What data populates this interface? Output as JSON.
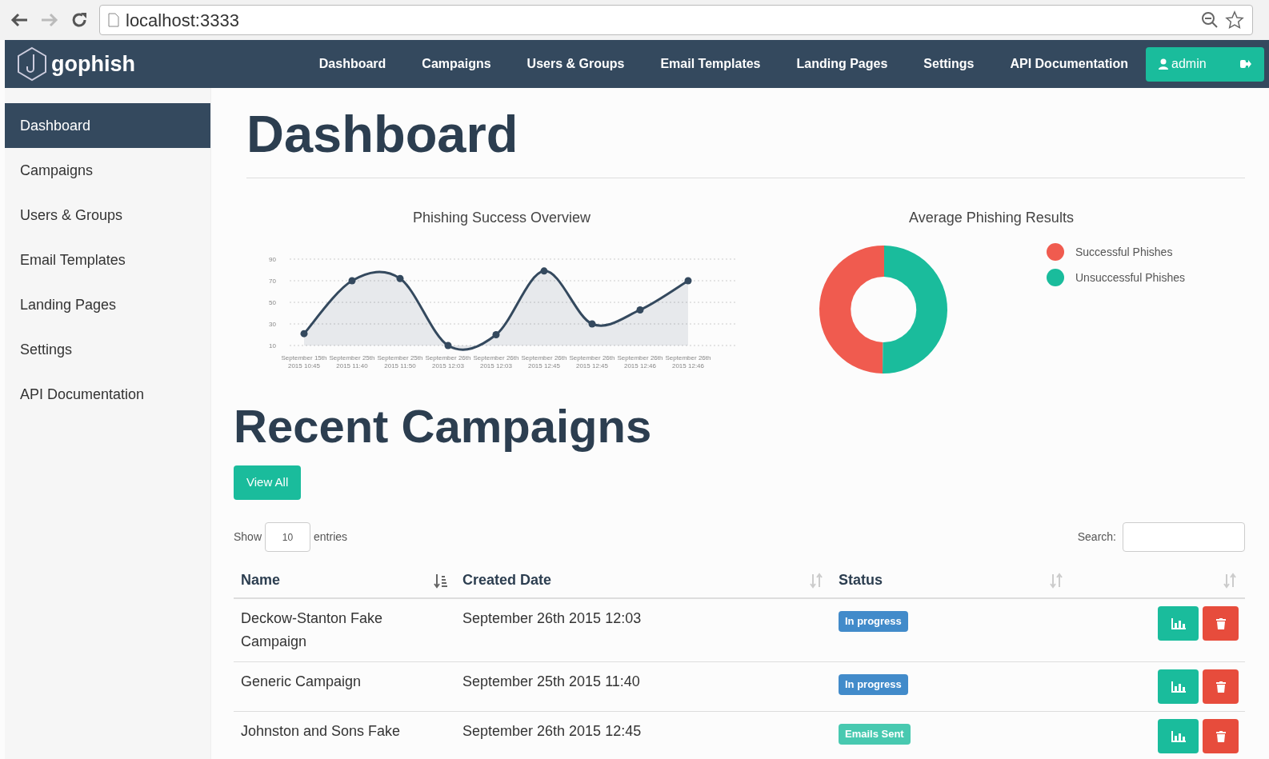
{
  "browser": {
    "url": "localhost:3333"
  },
  "navbar": {
    "brand": "gophish",
    "items": [
      {
        "label": "Dashboard"
      },
      {
        "label": "Campaigns"
      },
      {
        "label": "Users & Groups"
      },
      {
        "label": "Email Templates"
      },
      {
        "label": "Landing Pages"
      },
      {
        "label": "Settings"
      },
      {
        "label": "API Documentation"
      }
    ],
    "user": "admin"
  },
  "sidebar": {
    "items": [
      {
        "label": "Dashboard",
        "selected": true
      },
      {
        "label": "Campaigns",
        "selected": false
      },
      {
        "label": "Users & Groups",
        "selected": false
      },
      {
        "label": "Email Templates",
        "selected": false
      },
      {
        "label": "Landing Pages",
        "selected": false
      },
      {
        "label": "Settings",
        "selected": false
      },
      {
        "label": "API Documentation",
        "selected": false
      }
    ]
  },
  "page_title": "Dashboard",
  "line_chart": {
    "chart_data": {
      "type": "area",
      "title": "Phishing Success Overview",
      "categories": [
        "September 15th 2015 10:45",
        "September 25th 2015 11:40",
        "September 25th 2015 11:50",
        "September 26th 2015 12:03",
        "September 26th 2015 12:03",
        "September 26th 2015 12:45",
        "September 26th 2015 12:45",
        "September 26th 2015 12:46",
        "September 26th 2015 12:46"
      ],
      "series": [
        {
          "color": "#34495e",
          "values": [
            21,
            70,
            72,
            10,
            20,
            79,
            30,
            43,
            70
          ]
        }
      ],
      "ylim": [
        10,
        90
      ],
      "yticks": [
        10,
        30,
        50,
        70,
        90
      ],
      "grid": true
    }
  },
  "pie_chart": {
    "title": "Average Phishing Results",
    "legend": [
      {
        "label": "Successful Phishes",
        "color": "#f05b4f"
      },
      {
        "label": "Unsuccessful Phishes",
        "color": "#1abc9c"
      }
    ]
  },
  "recent": {
    "title": "Recent Campaigns",
    "view_all": "View All",
    "show_label": "Show",
    "entries_value": "10",
    "entries_label": "entries",
    "search_label": "Search:",
    "columns": [
      {
        "label": "Name",
        "sorted": true
      },
      {
        "label": "Created Date",
        "sorted": false
      },
      {
        "label": "Status",
        "sorted": false
      },
      {
        "sorted": false
      }
    ],
    "rows": [
      {
        "name": "Deckow-Stanton Fake Campaign",
        "created": "September 26th 2015 12:03",
        "status": "In progress",
        "color": "#428bca"
      },
      {
        "name": "Generic Campaign",
        "created": "September 25th 2015 11:40",
        "status": "In progress",
        "color": "#428bca"
      },
      {
        "name": "Johnston and Sons Fake",
        "created": "September 26th 2015 12:45",
        "status": "Emails Sent",
        "color": "#48c9b0"
      }
    ]
  }
}
